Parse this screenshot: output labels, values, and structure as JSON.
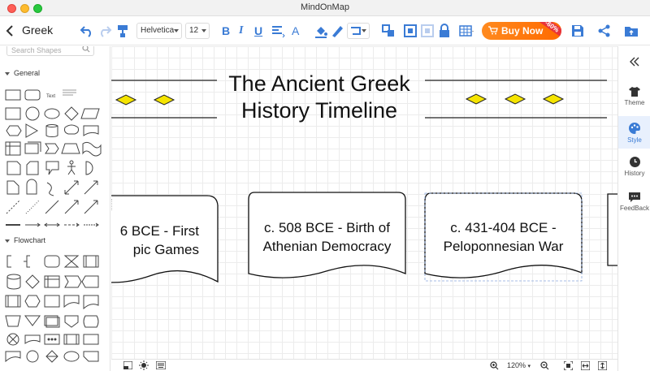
{
  "window": {
    "title": "MindOnMap"
  },
  "toolbar": {
    "doc_title": "Greek",
    "font_family": "Helvetica",
    "font_size": "12",
    "bold": "B",
    "italic": "I",
    "underline": "U",
    "font_color": "A",
    "buy_now": "Buy Now",
    "discount": "-60%"
  },
  "left_panel": {
    "search_placeholder": "Search Shapes",
    "sections": [
      "General",
      "Flowchart"
    ],
    "text_shape_label": "Text"
  },
  "canvas": {
    "title_line1": "The Ancient Greek",
    "title_line2": "History Timeline",
    "cards": [
      {
        "line1": "6 BCE - First",
        "line2": "pic Games"
      },
      {
        "line1": "c. 508 BCE - Birth of",
        "line2": "Athenian Democracy"
      },
      {
        "line1": "c. 431-404 BCE -",
        "line2": "Peloponnesian War"
      }
    ]
  },
  "right_panel": {
    "items": [
      "Theme",
      "Style",
      "History",
      "FeedBack"
    ],
    "active": "Style"
  },
  "bottom_bar": {
    "zoom": "120%"
  },
  "colors": {
    "accent": "#3a7bd5",
    "diamond": "#f5e400",
    "buy_now": "#ff7a10"
  }
}
